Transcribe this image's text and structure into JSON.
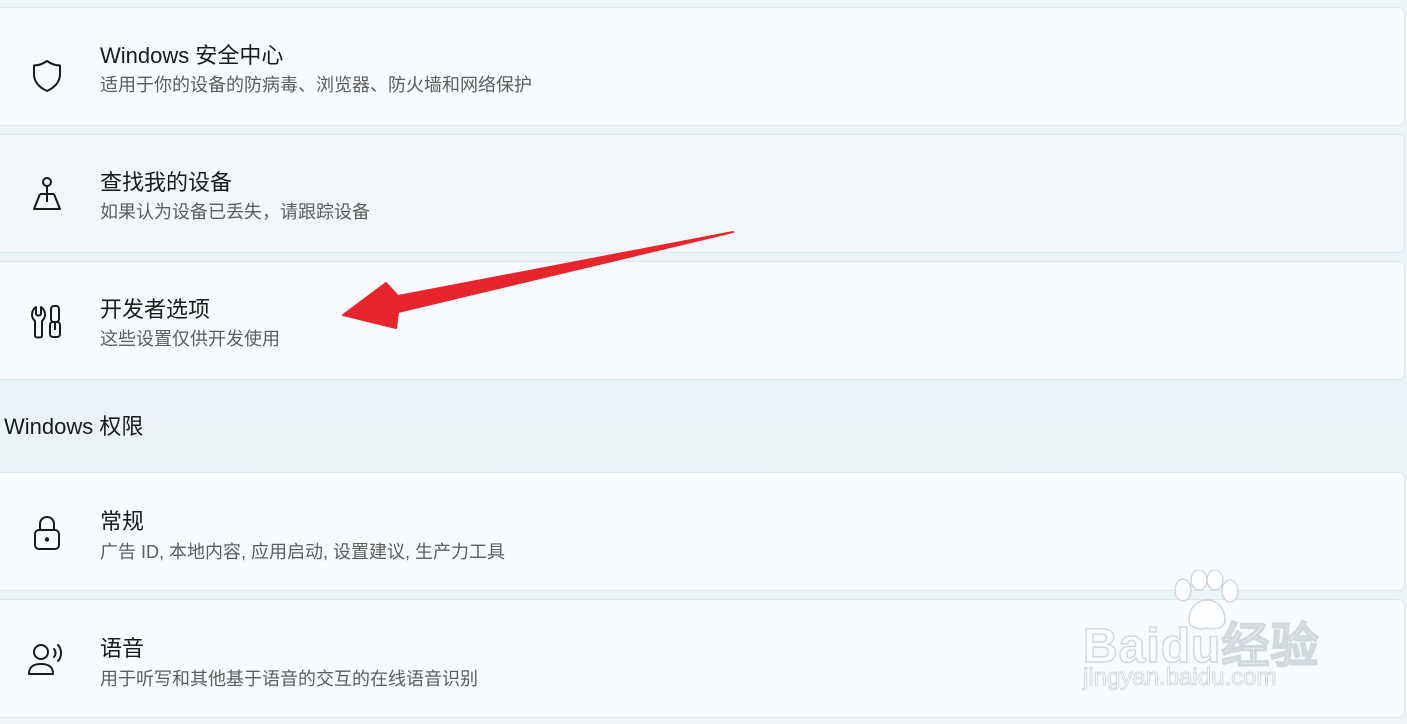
{
  "items": [
    {
      "title": "Windows 安全中心",
      "description": "适用于你的设备的防病毒、浏览器、防火墙和网络保护",
      "icon": "shield-icon"
    },
    {
      "title": "查找我的设备",
      "description": "如果认为设备已丢失，请跟踪设备",
      "icon": "find-device-icon"
    },
    {
      "title": "开发者选项",
      "description": "这些设置仅供开发使用",
      "icon": "developer-tools-icon"
    }
  ],
  "section": {
    "title": "Windows 权限"
  },
  "permissions": [
    {
      "title": "常规",
      "description": "广告 ID, 本地内容, 应用启动, 设置建议, 生产力工具",
      "icon": "lock-icon"
    },
    {
      "title": "语音",
      "description": "用于听写和其他基于语音的交互的在线语音识别",
      "icon": "speech-icon"
    }
  ],
  "watermark": {
    "brand": "Baidu经验",
    "url": "jingyan.baidu.com"
  },
  "colors": {
    "background": "#eaf3f7",
    "card": "#f8fbfd",
    "annotation_arrow": "#e8242c"
  }
}
